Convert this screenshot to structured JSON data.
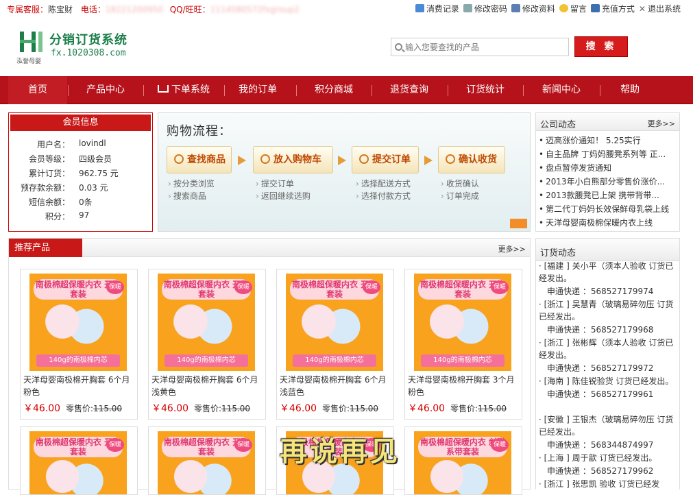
{
  "topbar": {
    "service_label": "专属客服：",
    "service_name": "陈宝财",
    "phone_label": "电话：",
    "phone_value": "18221200950",
    "qq_label": "QQ/旺旺：",
    "qq_value": "1114580572fxgroup2",
    "links": [
      "消费记录",
      "修改密码",
      "修改资料",
      "留言",
      "充值方式",
      "退出系统"
    ]
  },
  "logo": {
    "title": "分销订货系统",
    "url": "fx.1020308.com",
    "subtitle": "泓誉母婴"
  },
  "search": {
    "placeholder": "输入您要查找的产品",
    "button": "搜 索"
  },
  "nav": {
    "items": [
      "首页",
      "产品中心",
      "下单系统",
      "我的订单",
      "积分商城",
      "退货查询",
      "订货统计",
      "新闻中心",
      "帮助"
    ]
  },
  "member": {
    "title": "会员信息",
    "rows": [
      {
        "k": "用户名：",
        "v": "lovindl"
      },
      {
        "k": "会员等级：",
        "v": "四级会员"
      },
      {
        "k": "累计订货：",
        "v": "962.75 元"
      },
      {
        "k": "预存款余额：",
        "v": "0.03 元"
      },
      {
        "k": "短信余额：",
        "v": "0条"
      },
      {
        "k": "积分：",
        "v": "97"
      }
    ]
  },
  "flow": {
    "title": "购物流程：",
    "steps": [
      "查找商品",
      "放入购物车",
      "提交订单",
      "确认收货"
    ],
    "subs": [
      [
        "按分类浏览",
        "搜索商品"
      ],
      [
        "提交订单",
        "返回继续选购"
      ],
      [
        "选择配送方式",
        "选择付款方式"
      ],
      [
        "收货确认",
        "订单完成"
      ]
    ]
  },
  "news": {
    "title": "公司动态",
    "more": "更多>>",
    "items": [
      "迈高涨价通知！ 5.25实行",
      "自主品牌 丁妈妈腰凳系列等 正...",
      "盘点暂停发货通知",
      "2013年小白熊部分零售价涨价...",
      "2013款腰凳已上架 携带背带...",
      "第二代丁妈妈长效保鲜母乳袋上线",
      "天洋母婴南极棉保暖内衣上线"
    ]
  },
  "recommend": {
    "title": "推荐产品",
    "more": "更多>>",
    "image_text": {
      "banner": "南极棉超保暖内衣 开胸套装",
      "badge": "保暖",
      "bottom": "140g的南极棉内芯"
    },
    "products": [
      {
        "name": "天洋母婴南极棉开胸套 6个月粉色",
        "price": "￥46.00",
        "retail_label": "零售价:",
        "retail": "115.00"
      },
      {
        "name": "天洋母婴南极棉开胸套 6个月浅黄色",
        "price": "￥46.00",
        "retail_label": "零售价:",
        "retail": "115.00"
      },
      {
        "name": "天洋母婴南极棉开胸套 6个月浅蓝色",
        "price": "￥46.00",
        "retail_label": "零售价:",
        "retail": "115.00"
      },
      {
        "name": "天洋母婴南极棉开胸套 3个月粉色",
        "price": "￥46.00",
        "retail_label": "零售价:",
        "retail": "115.00"
      }
    ],
    "row2_banners": [
      "南极棉超保暖内衣 开胸套装",
      "南极棉超保暖内衣 开胸套装",
      "南极棉超保暖内衣 开胸套装",
      "南极棉超保暖内衣 斜襟系带套装"
    ],
    "overlay": "再说再见"
  },
  "orders": {
    "title": "订货动态",
    "entries": [
      {
        "text": "· [福建 ] 关小平（须本人验收 订货已经发出。",
        "track": "申通快递 ：568527179974"
      },
      {
        "text": "· [浙江 ] 吴慧青（玻璃易碎勿压 订货已经发出。",
        "track": "申通快递 ：568527179968"
      },
      {
        "text": "· [浙江 ] 张彬辉（须本人验收 订货已经发出。",
        "track": "申通快递 ：568527179972"
      },
      {
        "text": "· [海南 ] 陈佳锐验货 订货已经发出。",
        "track": "申通快递 ：568527179961"
      },
      {
        "text": "· [安徽 ] 王银杰（玻璃易碎勿压 订货已经发出。",
        "track": "申通快递 ：568344874997"
      },
      {
        "text": "· [上海 ] 周于歆 订货已经发出。",
        "track": "申通快递 ：568527179962"
      },
      {
        "text": "· [浙江 ] 张思凯 验收 订货已经发",
        "track": ""
      }
    ]
  },
  "colors": {
    "brand_red": "#b5121b",
    "accent_red": "#c81818",
    "logo_green": "#1c7f4a",
    "price_red": "#d80000"
  }
}
